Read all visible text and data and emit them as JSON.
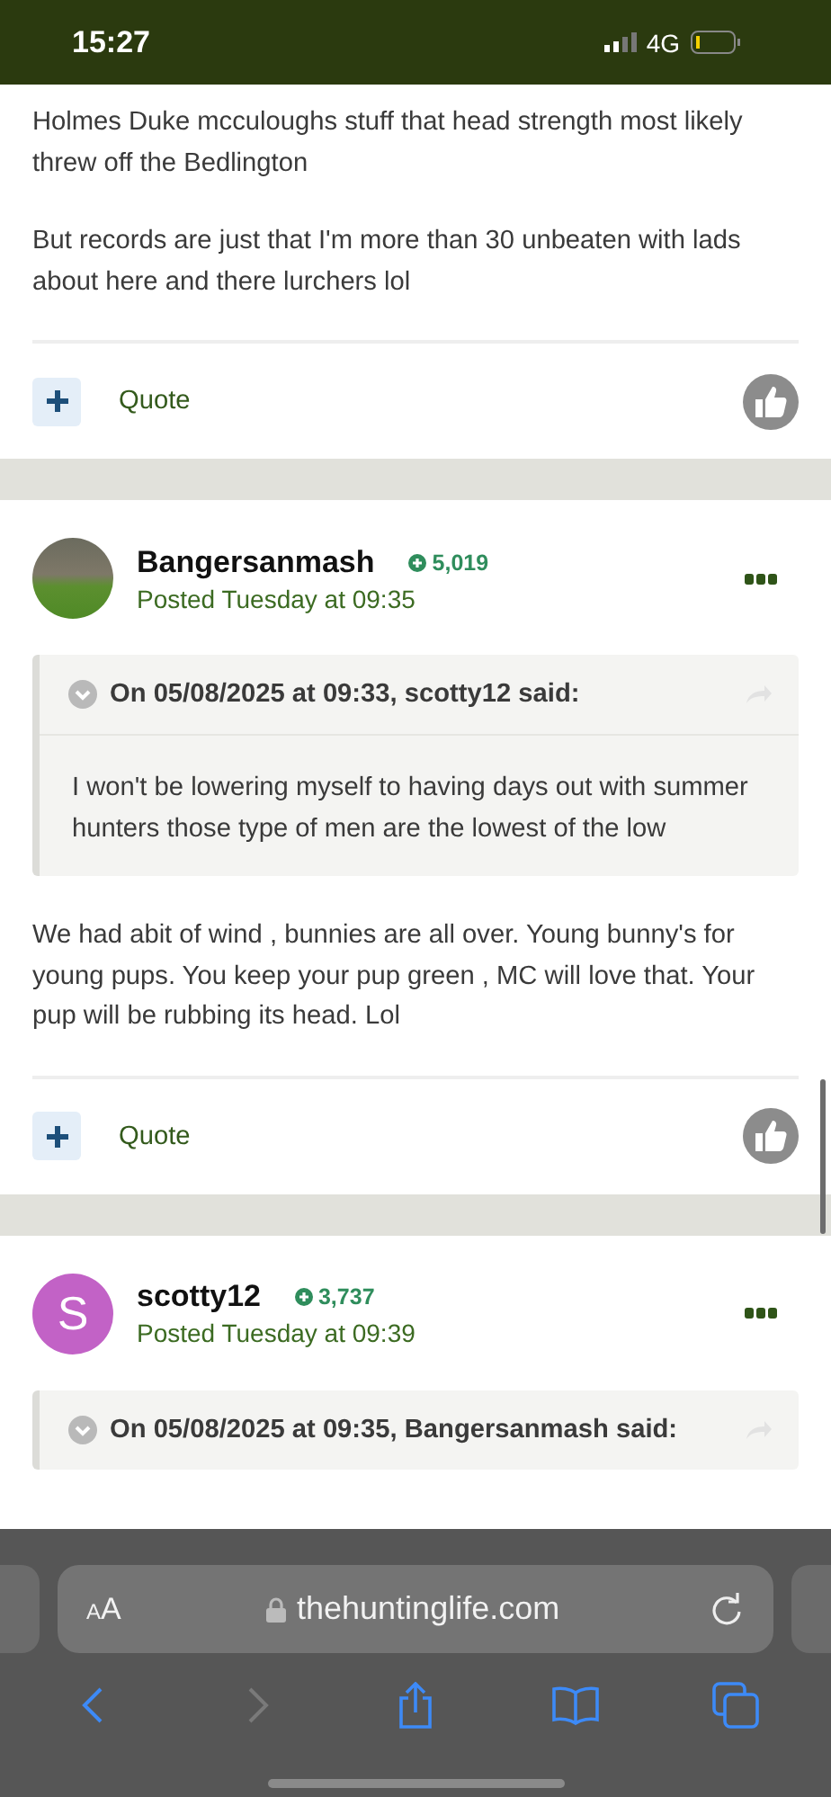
{
  "status_bar": {
    "time": "15:27",
    "network": "4G"
  },
  "posts": [
    {
      "paragraphs": [
        "Holmes Duke mcculoughs stuff that head strength most likely threw off the Bedlington",
        "But records are just that I'm more than  30 unbeaten with lads about here and there lurchers lol"
      ],
      "footer": {
        "quote_label": "Quote"
      }
    },
    {
      "author": "Bangersanmash",
      "avatar": {
        "kind": "photo"
      },
      "reputation": "5,019",
      "posted": "Posted Tuesday at 09:35",
      "quote": {
        "attribution": "On 05/08/2025 at 09:33, scotty12 said:",
        "text": "I won't be lowering myself to having days out with summer hunters those type of men are the lowest of the low"
      },
      "paragraphs": [
        "We had abit of wind , bunnies are all over. Young bunny's for young pups. You keep your pup green , MC will love that. Your pup will be rubbing its head. Lol"
      ],
      "footer": {
        "quote_label": "Quote"
      }
    },
    {
      "author": "scotty12",
      "avatar": {
        "kind": "letter",
        "letter": "S",
        "color": "#c262c6"
      },
      "reputation": "3,737",
      "posted": "Posted Tuesday at 09:39",
      "quote": {
        "attribution": "On 05/08/2025 at 09:35, Bangersanmash said:"
      }
    }
  ],
  "browser": {
    "text_size_label": "AA",
    "url": "thehuntinglife.com",
    "back_disabled": false,
    "forward_disabled": true
  }
}
